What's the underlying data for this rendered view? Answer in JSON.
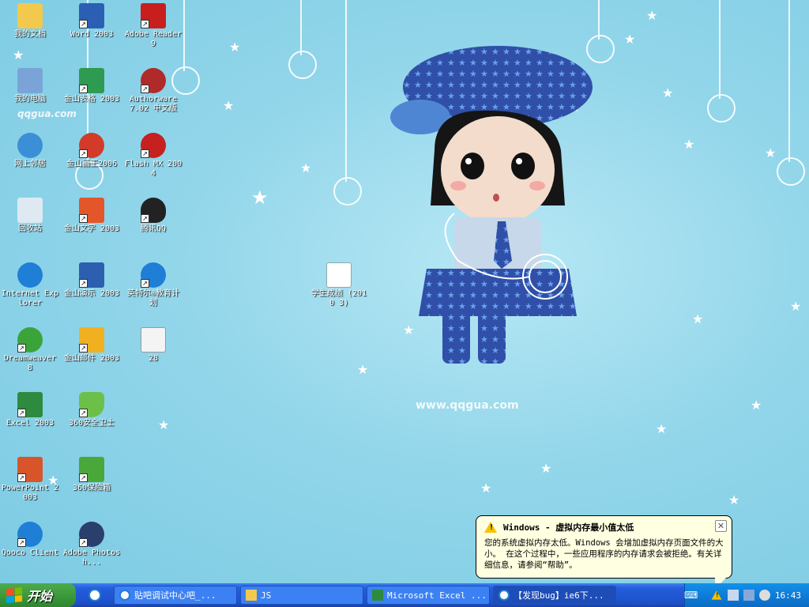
{
  "desktop": {
    "icons": [
      {
        "label": "我的文档",
        "icon": "my-documents-icon"
      },
      {
        "label": "Word 2003",
        "icon": "word-icon"
      },
      {
        "label": "Adobe Reader 9",
        "icon": "adobe-reader-icon"
      },
      {
        "label": "我的电脑",
        "icon": "my-computer-icon"
      },
      {
        "label": "金山表格 2003",
        "icon": "kingsoft-sheet-icon"
      },
      {
        "label": "Authorware 7.02 中文版",
        "icon": "authorware-icon"
      },
      {
        "label": "网上邻居",
        "icon": "network-icon"
      },
      {
        "label": "金山画王2006",
        "icon": "kingsoft-paint-icon"
      },
      {
        "label": "Flash MX 2004",
        "icon": "flash-icon"
      },
      {
        "label": "回收站",
        "icon": "recycle-bin-icon"
      },
      {
        "label": "金山文字 2003",
        "icon": "kingsoft-writer-icon"
      },
      {
        "label": "腾讯QQ",
        "icon": "qq-icon"
      },
      {
        "label": "Internet Explorer",
        "icon": "ie-icon"
      },
      {
        "label": "金山演示 2003",
        "icon": "kingsoft-present-icon"
      },
      {
        "label": "英特尔®教育计划",
        "icon": "intel-edu-icon"
      },
      {
        "label": "Dreamweaver 8",
        "icon": "dreamweaver-icon"
      },
      {
        "label": "金山邮件 2003",
        "icon": "kingsoft-mail-icon"
      },
      {
        "label": "28",
        "icon": "png-file-icon"
      },
      {
        "label": "Excel 2003",
        "icon": "excel-icon"
      },
      {
        "label": "360安全卫士",
        "icon": "360-safe-icon"
      },
      {
        "label": "PowerPoint 2003",
        "icon": "powerpoint-icon"
      },
      {
        "label": "360保险箱",
        "icon": "360-safebox-icon"
      },
      {
        "label": "Qooco Client",
        "icon": "qooco-icon"
      },
      {
        "label": "Adobe Photosh...",
        "icon": "photoshop-icon"
      },
      {
        "label": "学生成绩 (2010 3)",
        "icon": "excel-file-icon"
      }
    ],
    "watermark_top": "qqgua.com",
    "watermark_bottom": "www.qqgua.com"
  },
  "balloon": {
    "title": "Windows - 虚拟内存最小值太低",
    "message": "您的系统虚拟内存太低。Windows 会增加虚拟内存页面文件的大小。 在这个过程中，一些应用程序的内存请求会被拒绝。有关详细信息，请参阅“帮助”。",
    "close": "✕"
  },
  "taskbar": {
    "start_label": "开始",
    "tasks": [
      {
        "label": "贴吧调试中心吧_...",
        "icon": "ie-icon"
      },
      {
        "label": "JS",
        "icon": "folder-icon"
      },
      {
        "label": "Microsoft Excel ...",
        "icon": "excel-icon"
      },
      {
        "label": "【发现bug】ie6下...",
        "icon": "ie-icon"
      }
    ],
    "clock": "16:43"
  },
  "colors": {
    "taskbar": "#245edb",
    "start": "#3c9a3c",
    "tray": "#0f7dd8",
    "balloon": "#ffffe1"
  }
}
